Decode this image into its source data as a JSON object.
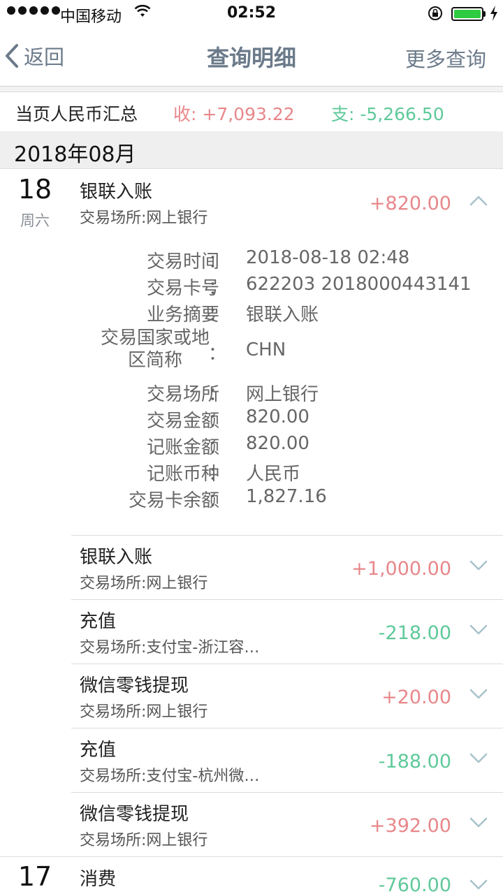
{
  "status_bar": {
    "carrier": "中国移动",
    "time": "02:52"
  },
  "nav": {
    "back_label": "返回",
    "title": "查询明细",
    "more_label": "更多查询"
  },
  "summary": {
    "label": "当页人民币汇总",
    "income": "收: +7,093.22",
    "expense": "支: -5,266.50"
  },
  "month": "2018年08月",
  "days": [
    {
      "day": "18",
      "weekday": "周六"
    },
    {
      "day": "17",
      "weekday": ""
    }
  ],
  "expanded": {
    "name": "银联入账",
    "place": "交易场所:网上银行",
    "amount": "+820.00",
    "details": [
      {
        "key": "交易时间",
        "value": "2018-08-18 02:48"
      },
      {
        "key": "交易卡号",
        "value": "622203 2018000443141"
      },
      {
        "key": "业务摘要",
        "value": "银联入账"
      },
      {
        "key": "交易国家或地",
        "key_line2": "区简称",
        "value": "CHN"
      },
      {
        "key": "交易场所",
        "value": "网上银行"
      },
      {
        "key": "交易金额",
        "value": "820.00"
      },
      {
        "key": "记账金额",
        "value": "820.00"
      },
      {
        "key": "记账币种",
        "value": "人民币"
      },
      {
        "key": "交易卡余额",
        "value": "1,827.16"
      }
    ]
  },
  "transactions": [
    {
      "name": "银联入账",
      "place": "交易场所:网上银行",
      "amount": "+1,000.00",
      "sign": "pos"
    },
    {
      "name": "充值",
      "place": "交易场所:支付宝-浙江容…",
      "amount": "-218.00",
      "sign": "neg"
    },
    {
      "name": "微信零钱提现",
      "place": "交易场所:网上银行",
      "amount": "+20.00",
      "sign": "pos"
    },
    {
      "name": "充值",
      "place": "交易场所:支付宝-杭州微…",
      "amount": "-188.00",
      "sign": "neg"
    },
    {
      "name": "微信零钱提现",
      "place": "交易场所:网上银行",
      "amount": "+392.00",
      "sign": "pos"
    },
    {
      "name": "消费",
      "place": "",
      "amount": "-760.00",
      "sign": "neg"
    }
  ],
  "detail_colon": "：",
  "colors": {
    "income": "#e8878a",
    "expense": "#5fc99a",
    "nav": "#6b7a8a",
    "battery": "#2ecc40"
  },
  "icons": [
    "signal-dots-icon",
    "wifi-icon",
    "orientation-lock-icon",
    "battery-icon",
    "charging-bolt-icon",
    "chevron-left-icon",
    "chevron-up-icon",
    "chevron-down-icon"
  ]
}
